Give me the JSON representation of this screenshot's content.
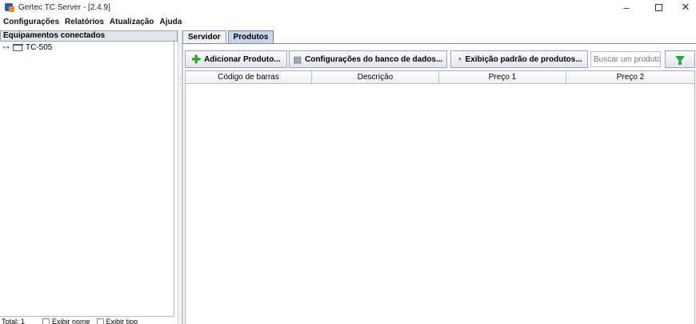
{
  "window": {
    "title": "Gertec TC Server - [2.4.9]",
    "minimize": "–",
    "close": "✕"
  },
  "menu": [
    "Configurações",
    "Relatórios",
    "Atualização",
    "Ajuda"
  ],
  "left": {
    "header": "Equipamentos conectados",
    "tree": [
      {
        "label": "TC-505",
        "icon": "folder-icon"
      }
    ],
    "footer": {
      "total": "Total: 1",
      "opt1": "Exibir nome",
      "opt2": "Exibir tipo"
    }
  },
  "tabs": [
    {
      "label": "Servidor",
      "active": false
    },
    {
      "label": "Produtos",
      "active": true
    }
  ],
  "toolbar": {
    "add_label": "Adicionar Produto...",
    "db_label": "Configurações do banco de dados...",
    "view_label": "Exibição padrão de produtos...",
    "search_placeholder": "Buscar um produto",
    "filter_icon": "filter-icon"
  },
  "table": {
    "columns": [
      "Código de barras",
      "Descrição",
      "Preço 1",
      "Preço 2"
    ],
    "rows": []
  },
  "colors": {
    "tab_active": "#c8d4ea",
    "add_icon": "#2da52d",
    "filter_icon": "#2aa64a"
  }
}
